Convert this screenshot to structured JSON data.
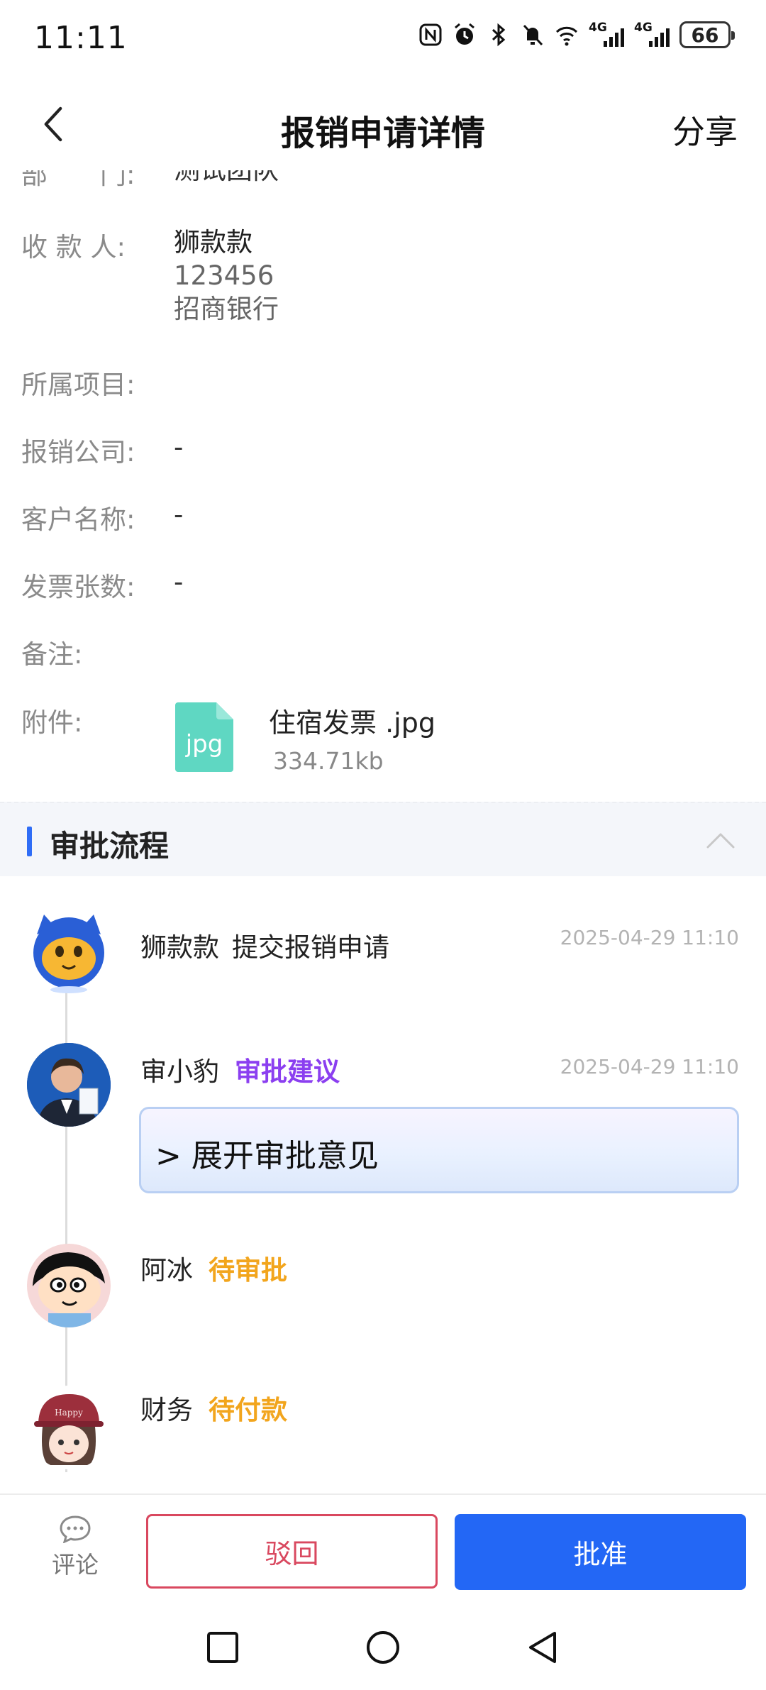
{
  "status_bar": {
    "time": "11:11",
    "icons": [
      "nfc-icon",
      "alarm-icon",
      "bluetooth-icon",
      "mute-icon",
      "wifi-icon",
      "signal-4g-icon",
      "signal-4g-icon",
      "battery-icon"
    ],
    "network_tag_1": "4G",
    "network_tag_2": "4G",
    "battery": "66"
  },
  "nav": {
    "title": "报销申请详情",
    "share": "分享",
    "back_icon": "chevron-left-icon"
  },
  "details": {
    "department_label": "部　　门:",
    "department_value": "测试团队",
    "payee_label": "收 款 人:",
    "payee_name": "狮款款",
    "payee_account": "123456",
    "payee_bank": "招商银行",
    "project_label": "所属项目:",
    "project_value": "",
    "company_label": "报销公司:",
    "company_value": "-",
    "customer_label": "客户名称:",
    "customer_value": "-",
    "invoice_count_label": "发票张数:",
    "invoice_count_value": "-",
    "remark_label": "备注:",
    "remark_value": "",
    "attachment_label": "附件:",
    "attachment": {
      "icon_text": "jpg",
      "name": "住宿发票 .jpg",
      "size": "334.71kb"
    }
  },
  "approval": {
    "section_title": "审批流程",
    "steps": [
      {
        "name": "狮款款",
        "action": "提交报销申请",
        "status": "",
        "time": "2025-04-29 11:10"
      },
      {
        "name": "审小豹",
        "action": "",
        "status": "审批建议",
        "time": "2025-04-29 11:10",
        "opinion_toggle": "> 展开审批意见"
      },
      {
        "name": "阿冰",
        "action": "",
        "status": "待审批",
        "time": ""
      },
      {
        "name": "财务",
        "action": "",
        "status": "待付款",
        "time": ""
      }
    ]
  },
  "actions": {
    "comment": "评论",
    "reject": "驳回",
    "approve": "批准"
  },
  "colors": {
    "primary": "#2367f5",
    "reject": "#d9485f",
    "status_suggest": "#8b3ff0",
    "status_pending": "#f2a51d",
    "file_icon": "#5fd7c2"
  }
}
